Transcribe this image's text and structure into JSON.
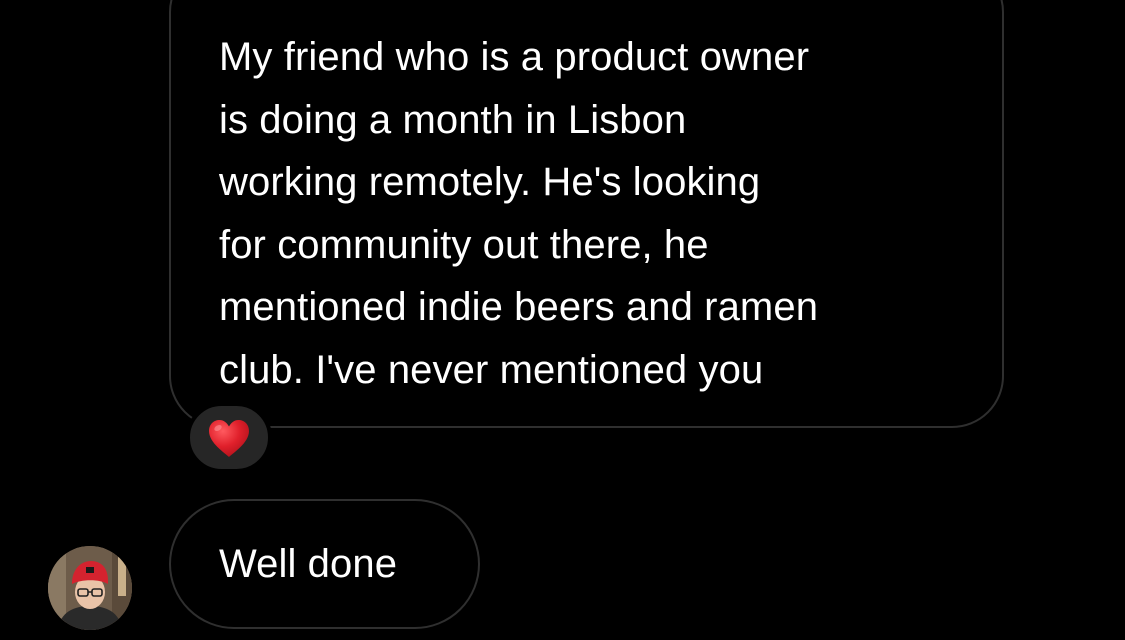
{
  "conversation": {
    "messages": [
      {
        "text": "My friend who is a product owner\nis doing a month in Lisbon\nworking remotely. He's looking\nfor community out there, he\nmentioned indie beers and ramen\nclub. I've never mentioned you",
        "reaction": "red-heart-emoji"
      },
      {
        "text": "Well done",
        "sender_avatar": "avatar-photo"
      }
    ]
  },
  "colors": {
    "background": "#000000",
    "bubble_border": "#2f2f2f",
    "reaction_background": "#262626",
    "heart": "#e0202b",
    "text": "#ffffff"
  }
}
